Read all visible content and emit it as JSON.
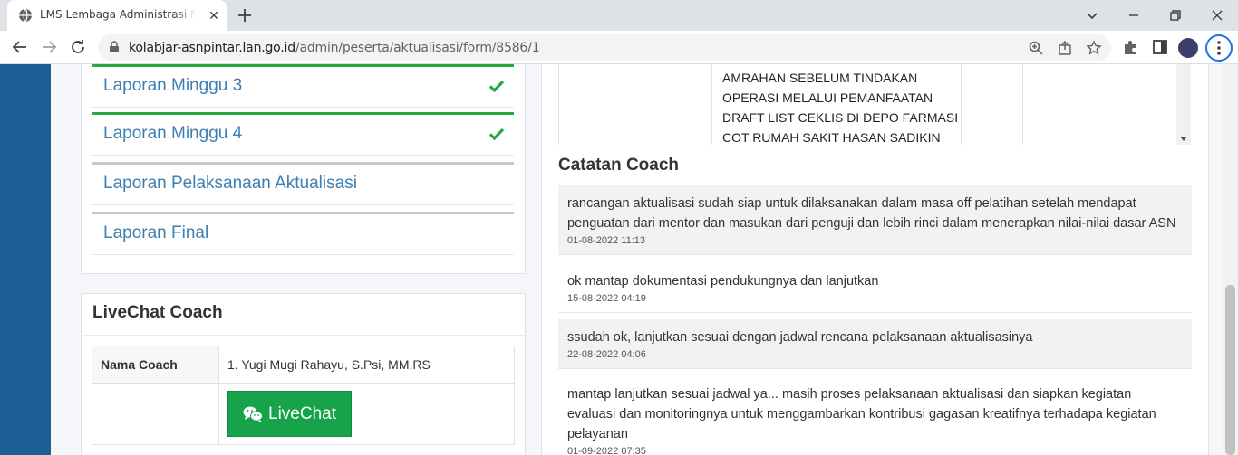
{
  "browser": {
    "tab_title": "LMS Lembaga Administrasi Negara",
    "tab_close": "✕",
    "url_host": "kolabjar-asnpintar.lan.go.id",
    "url_path": "/admin/peserta/aktualisasi/form/8586/1"
  },
  "reports": [
    {
      "label": "Laporan Minggu 3",
      "done": true
    },
    {
      "label": "Laporan Minggu 4",
      "done": true
    },
    {
      "label": "Laporan Pelaksanaan Aktualisasi",
      "done": false
    },
    {
      "label": "Laporan Final",
      "done": false
    }
  ],
  "livechat": {
    "title": "LiveChat Coach",
    "coach_label": "Nama Coach",
    "coach_name": "1. Yugi Mugi Rahayu, S.Psi, MM.RS",
    "button_label": "LiveChat"
  },
  "action_text": [
    "AMRAHAN SEBELUM TINDAKAN",
    "OPERASI MELALUI PEMANFAATAN",
    "DRAFT LIST CEKLIS DI DEPO FARMASI",
    "COT RUMAH SAKIT HASAN SADIKIN"
  ],
  "catatan": {
    "title": "Catatan Coach",
    "notes": [
      {
        "text": "rancangan aktualisasi sudah siap untuk dilaksanakan dalam masa off pelatihan setelah mendapat penguatan dari mentor dan masukan dari penguji dan lebih rinci dalam menerapkan nilai-nilai dasar ASN",
        "time": "01-08-2022 11:13"
      },
      {
        "text": "ok mantap dokumentasi pendukungnya dan lanjutkan",
        "time": "15-08-2022 04:19"
      },
      {
        "text": "ssudah ok, lanjutkan sesuai dengan jadwal rencana pelaksanaan aktualisasinya",
        "time": "22-08-2022 04:06"
      },
      {
        "text": "mantap lanjutkan sesuai jadwal ya... masih proses pelaksanaan aktualisasi dan siapkan kegiatan evaluasi dan monitoringnya untuk menggambarkan kontribusi gagasan kreatifnya terhadapa kegiatan pelayanan",
        "time": "01-09-2022 07:35"
      }
    ]
  },
  "colors": {
    "sidebar": "#1b5e96",
    "link": "#3d7fb0",
    "success": "#28a745",
    "livechat_button": "#16a34a"
  }
}
